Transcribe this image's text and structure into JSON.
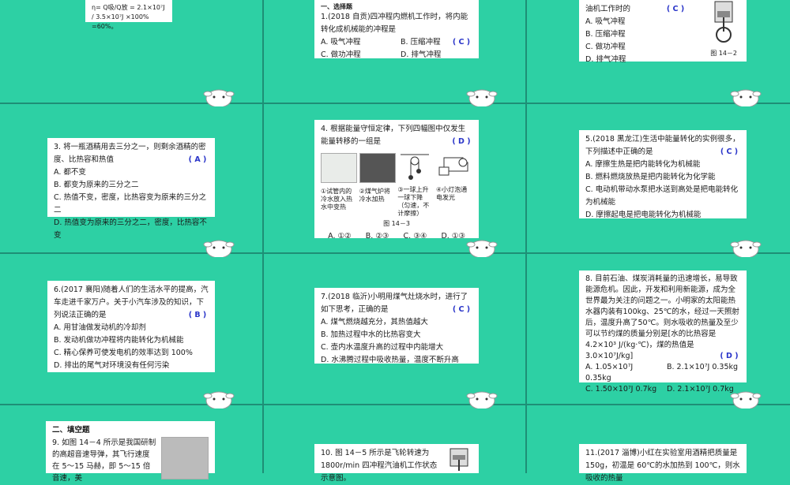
{
  "colors": {
    "background": "#2dd0a4",
    "card": "#ffffff",
    "answer": "#2a35c9"
  },
  "slides": {
    "s1": {
      "formula_lines": [
        "η= Q吸/Q放 = 2.1×10⁷J / 3.5×10⁷J ×100% =60%。"
      ]
    },
    "s2": {
      "section": "一、选择题",
      "q1": "1.(2018 自贡)四冲程内燃机工作时，将内能转化成机械能的冲程是",
      "answer": "( C )",
      "opts": [
        "A. 吸气冲程",
        "B. 压缩冲程",
        "C. 做功冲程",
        "D. 排气冲程"
      ]
    },
    "s3": {
      "stem": "油机工作时的",
      "answer": "( C )",
      "opts": [
        "A. 吸气冲程",
        "B. 压缩冲程",
        "C. 做功冲程",
        "D. 排气冲程"
      ],
      "fig_caption": "图 14－2"
    },
    "s4": {
      "q3": "3. 将一瓶酒精用去三分之一，则剩余酒精的密度、比热容和热值",
      "answer": "( A )",
      "opts": [
        "A. 都不变",
        "B. 都变为原来的三分之二",
        "C. 热值不变，密度，比热容变为原来的三分之二",
        "D. 热值变为原来的三分之二，密度，比热容不变"
      ]
    },
    "s5": {
      "q4": "4. 根据能量守恒定律，下列四幅图中仅发生能量转移的一组是",
      "answer": "( D )",
      "fig_labels": [
        "①试管内的冷水放入热水中变热",
        "②煤气炉将冷水加热",
        "③一球上升一球下降（匀速，不计摩擦）",
        "④小灯泡通电发光"
      ],
      "fig_caption": "图 14－3",
      "opts": [
        "A. ①②",
        "B. ②③",
        "C. ③④",
        "D. ①③"
      ]
    },
    "s6": {
      "q5": "5.(2018 黑龙江)生活中能量转化的实例很多，下列描述中正确的是",
      "answer": "( C )",
      "opts": [
        "A. 摩擦生热是把内能转化为机械能",
        "B. 燃料燃烧放热是把内能转化为化学能",
        "C. 电动机带动水泵把水送到高处是把电能转化为机械能",
        "D. 摩擦起电是把电能转化为机械能"
      ]
    },
    "s7": {
      "q6": "6.(2017 襄阳)随着人们的生活水平的提高，汽车走进千家万户。关于小汽车涉及的知识，下列说法正确的是",
      "answer": "( B )",
      "opts": [
        "A. 用甘油做发动机的冷却剂",
        "B. 发动机做功冲程将内能转化为机械能",
        "C. 精心保养可使发电机的效率达到 100%",
        "D. 排出的尾气对环境没有任何污染"
      ]
    },
    "s8": {
      "q7": "7.(2018 临沂)小明用煤气灶烧水时，进行了如下思考，正确的是",
      "answer": "( C )",
      "opts": [
        "A. 煤气燃烧越充分，其热值越大",
        "B. 加热过程中水的比热容变大",
        "C. 壶内水温度升高的过程中内能增大",
        "D. 水沸腾过程中吸收热量，温度不断升高"
      ]
    },
    "s9": {
      "q8": "8. 目前石油、煤炭消耗量的迅速增长，易导致能源危机。因此，开发和利用新能源，成为全世界最为关注的问题之一。小明家的太阳能热水器内装有100kg、25℃的水，经过一天照射后，温度升高了50℃。则水吸收的热量及至少可以节约煤的质量分别是[水的比热容是 4.2×10³ J/(kg·℃)，煤的热值是 3.0×10⁷J/kg]",
      "answer": "( D )",
      "opts": [
        "A. 1.05×10⁷J  0.35kg",
        "B. 2.1×10⁷J  0.35kg",
        "C. 1.50×10⁷J  0.7kg",
        "D. 2.1×10⁷J  0.7kg"
      ]
    },
    "s10": {
      "section": "二、填空题",
      "q9": "9. 如图 14－4 所示是我国研制的高超音速导弹，其飞行速度在 5～15 马赫，即 5～15 倍音速，美"
    },
    "s11": {
      "q10": "10. 图 14－5 所示是飞轮转速为 1800r/min 四冲程汽油机工作状态示意图。"
    },
    "s12": {
      "q11": "11.(2017 淄博)小红在实验室用酒精把质量是 150g，初温是 60℃的水加热到 100℃，则水吸收的热量"
    }
  }
}
